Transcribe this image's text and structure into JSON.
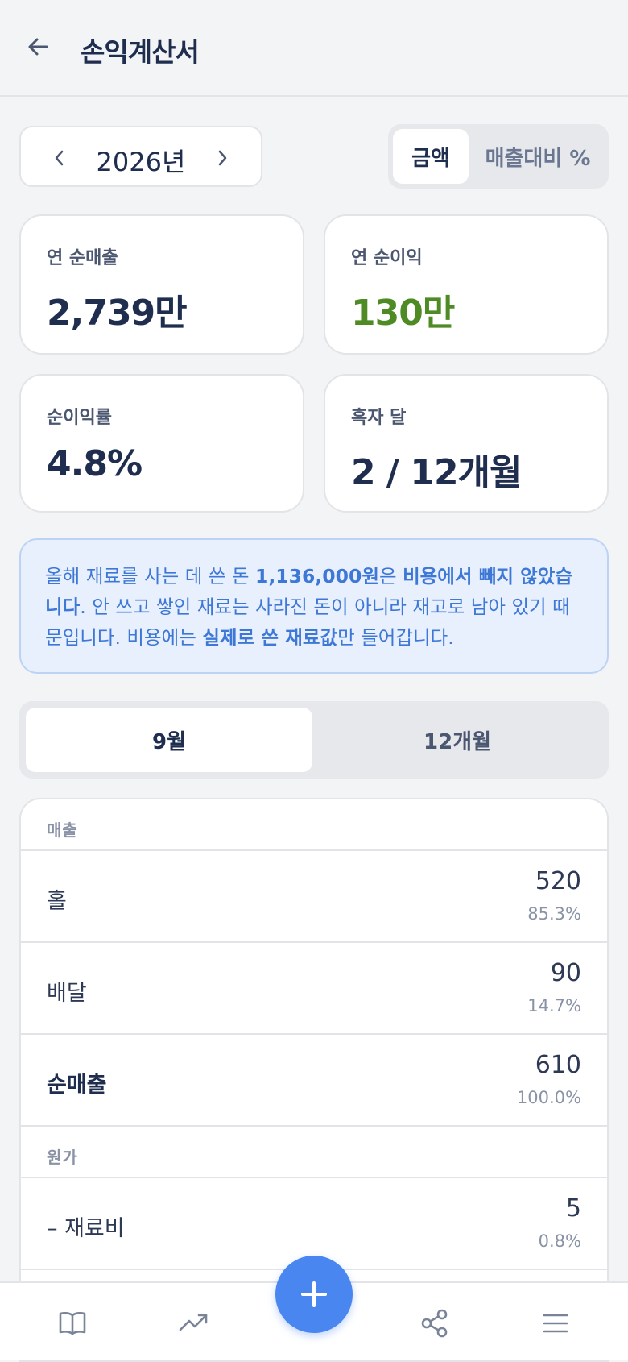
{
  "header": {
    "title": "손익계산서"
  },
  "year_selector": {
    "label": "2026년"
  },
  "view_toggle": {
    "amount": "금액",
    "ratio": "매출대비 %"
  },
  "summary_cards": [
    {
      "label": "연 순매출",
      "value": "2,739만"
    },
    {
      "label": "연 순이익",
      "value": "130만",
      "color": "#4E8B25"
    },
    {
      "label": "순이익률",
      "value": "4.8%"
    },
    {
      "label": "흑자 달",
      "value": "2 / 12개월"
    }
  ],
  "notice": {
    "part1": "올해 재료를 사는 데 쓴 돈 ",
    "amount": "1,136,000원",
    "part2": "은 ",
    "bold1": "비용에서 빼지 않았습니다",
    "part3": ". 안 쓰고 쌓인 재료는 사라진 돈이 아니라 재고로 남아 있기 때문입니다. 비용에는 ",
    "bold2": "실제로 쓴 재료값",
    "part4": "만 들어갑니다."
  },
  "period_tabs": {
    "month": "9월",
    "year": "12개월"
  },
  "table": {
    "revenue_section": "매출",
    "rows": [
      {
        "label": "홀",
        "value": "520",
        "pct": "85.3%"
      },
      {
        "label": "배달",
        "value": "90",
        "pct": "14.7%"
      },
      {
        "label": "순매출",
        "value": "610",
        "pct": "100.0%"
      }
    ],
    "cost_section": "원가",
    "cost_rows": [
      {
        "label": "– 재료비",
        "value": "5",
        "pct": "0.8%"
      }
    ]
  },
  "colors": {
    "accent": "#4A86F0",
    "profit": "#4E8B25",
    "notice_text": "#3E78D6"
  },
  "icons": {
    "back": "arrow-left-icon",
    "prev": "chevron-left-icon",
    "next": "chevron-right-icon",
    "nav": [
      "book-icon",
      "trending-up-icon",
      "plus-icon",
      "share-icon",
      "menu-icon"
    ]
  }
}
